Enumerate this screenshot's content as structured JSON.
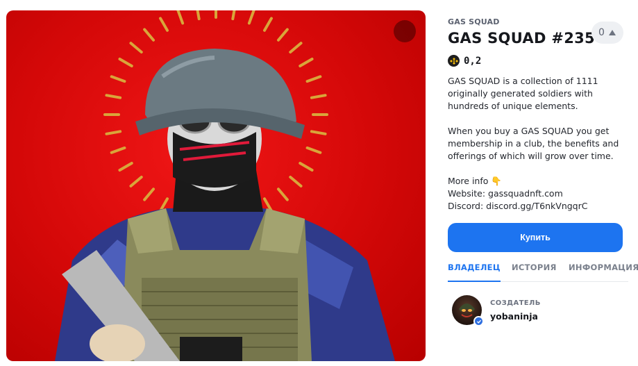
{
  "collection": {
    "name": "GAS SQUAD"
  },
  "item": {
    "title": "GAS SQUAD #235"
  },
  "likes": {
    "count": "0"
  },
  "price": {
    "value": "0,2",
    "currency_icon": "bnb-coin-icon"
  },
  "description": {
    "p1": "GAS SQUAD is a collection of 1111 originally generated soldiers with hundreds of unique elements.",
    "p2": "When you buy a GAS SQUAD you get membership in a club, the benefits and offerings of which will grow over time.",
    "more_info": "More info 👇",
    "website": "Website: gassquadnft.com",
    "discord": "Discord: discord.gg/T6nkVngqrC"
  },
  "actions": {
    "buy_label": "Купить"
  },
  "tabs": [
    {
      "label": "ВЛАДЕЛЕЦ"
    },
    {
      "label": "ИСТОРИЯ"
    },
    {
      "label": "ИНФОРМАЦИЯ"
    }
  ],
  "creator": {
    "role": "СОЗДАТЕЛЬ",
    "name": "yobaninja"
  },
  "colors": {
    "accent": "#1d74f0",
    "art_background": "#d40808",
    "coin": "#f0b90b"
  }
}
